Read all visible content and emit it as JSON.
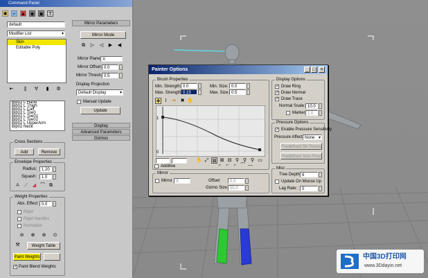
{
  "command_panel": {
    "title": "Command Panel",
    "object_name": "default",
    "modifier_list": "Modifier List",
    "stack": [
      "Skin",
      "Editable Poly"
    ],
    "bones": [
      "Bip02 L Hand",
      "Bip02 L Thigh",
      "Bip02 L Calf",
      "Bip02 L Toe0",
      "Bip02 L Toe01",
      "Bip02 L Toe02",
      "Bip02 L UpperArm",
      "Bip02 Neck"
    ],
    "cross_sections": {
      "title": "Cross Sections",
      "add": "Add",
      "remove": "Remove"
    },
    "envelope": {
      "title": "Envelope Properties",
      "radius_label": "Radius:",
      "radius": "1.20",
      "squash_label": "Squash:",
      "squash": "1.0"
    },
    "weight": {
      "title": "Weight Properties",
      "abs_effect_label": "Abs. Effect:",
      "abs_effect": "0.0",
      "rigid": "Rigid",
      "rigid_handles": "Rigid Handles",
      "normalize": "Normalize",
      "weight_table": "Weight Table",
      "paint_weights": "Paint Weights",
      "paint_blend": "Paint Blend Weights"
    }
  },
  "mirror_panel": {
    "title": "Mirror Parameters",
    "mirror_mode": "Mirror Mode",
    "plane_label": "Mirror Plane:",
    "plane": "X",
    "offset_label": "Mirror Offset:",
    "offset": "0.0",
    "thresh_label": "Mirror Thresh.:",
    "thresh": "0.5",
    "projection_title": "Display Projection",
    "projection": "Default Display",
    "manual_update": "Manual Update",
    "update": "Update",
    "rollouts": [
      "Display",
      "Advanced Parameters",
      "Gizmos"
    ]
  },
  "painter": {
    "title": "Painter Options",
    "brush": {
      "title": "Brush Properties",
      "min_strength_label": "Min. Strength:",
      "min_strength": "0.0",
      "max_strength_label": "Max. Strength:",
      "max_strength": "0.15",
      "min_size_label": "Min. Size:",
      "min_size": "0.0",
      "max_size_label": "Max. Size:",
      "max_size": "0.5"
    },
    "curve_labels": [
      "1",
      "0"
    ],
    "curve_value": "",
    "additive": "Additive",
    "mirror": {
      "title": "Mirror",
      "mirror": "Mirror",
      "axis": "X",
      "offset_label": "Offset:",
      "offset": "0.0",
      "gizmo_label": "Gizmo Size:",
      "gizmo": "50.0"
    },
    "display": {
      "title": "Display Options",
      "draw_ring": "Draw Ring",
      "draw_normal": "Draw Normal",
      "draw_trace": "Draw Trace",
      "normal_scale_label": "Normal Scale:",
      "normal_scale": "10.0",
      "marker": "Marker:",
      "marker_val": "1.0"
    },
    "pressure": {
      "title": "Pressure Options",
      "enable": "Enable Pressure Sensitivity",
      "affects_label": "Pressure Affects:",
      "affects": "None",
      "pred_str": "Predefined Str Pressure",
      "pred_size": "Predefined Size Pressure"
    },
    "misc": {
      "title": "Misc",
      "tree_depth_label": "Tree Depth:",
      "tree_depth": "6",
      "update_mouse": "Update On Mouse Up",
      "lag_label": "Lag Rate:",
      "lag": "0"
    }
  },
  "watermark": {
    "brand": "中国3D打印网",
    "url": "www.3Ddayin.net"
  },
  "colors": {
    "title_blue": "#0a246a",
    "selection_yellow": "#f2e600",
    "panel_gray": "#c8c8c8"
  }
}
